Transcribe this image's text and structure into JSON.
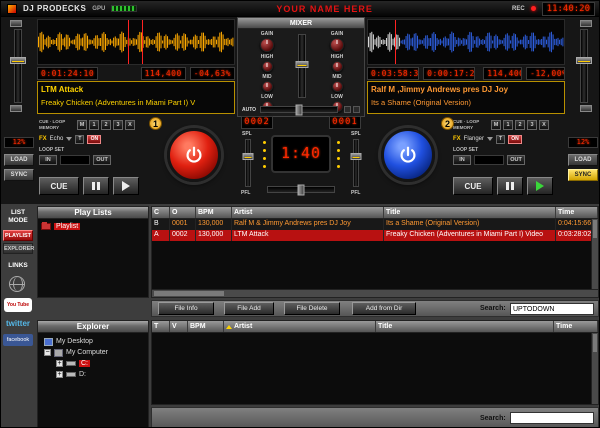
{
  "colors": {
    "deck_left_wave": "#ffaa00",
    "deck_right_wave": "#2e5fe0",
    "accent_red": "#cc1111",
    "digital_red": "#ff2800"
  },
  "header": {
    "logo": "DJ PRODECKS",
    "gpu_label": "GPU",
    "banner": "YOUR NAME HERE",
    "rec_label": "REC",
    "clock": "11:40:20"
  },
  "mixer": {
    "title": "MIXER",
    "gain_label": "GAIN",
    "eq_labels": [
      "HIGH",
      "MID",
      "LOW"
    ],
    "auto_label": "AUTO",
    "left_counter": "0002",
    "right_counter": "0001",
    "center_display": "1:40",
    "spl_label": "SPL",
    "pfl_label": "PFL"
  },
  "deck_left": {
    "badge": "1",
    "elapsed": "0:01:24:10",
    "bpm": "114,400",
    "pitch_value": "-04,63%",
    "artist_line": "LTM Attack",
    "title_line": "Freaky Chicken (Adventures in Miami Part I) V",
    "cue_loop_label": "CUE · LOOP MEMORY",
    "memory_buttons": [
      "M",
      "1",
      "2",
      "3",
      "X"
    ],
    "fx_prefix": "FX",
    "fx_name": "Echo",
    "fx_t": "T",
    "fx_on": "ON",
    "loop_set_label": "LOOP SET",
    "loop_in": "IN",
    "loop_out": "OUT",
    "pitch_display": "12%",
    "load_label": "LOAD",
    "sync_label": "SYNC",
    "cue_label": "CUE"
  },
  "deck_right": {
    "badge": "2",
    "elapsed": "0:03:58:37",
    "remaining": "0:00:17:28",
    "bpm": "114,400",
    "pitch_value": "-12,00%",
    "artist_line": "Ralf M ,Jimmy Andrews pres DJ Joy",
    "title_line": "Its a Shame (Original Version)",
    "cue_loop_label": "CUE · LOOP MEMORY",
    "memory_buttons": [
      "M",
      "1",
      "2",
      "3",
      "X"
    ],
    "fx_prefix": "FX",
    "fx_name": "Flanger",
    "fx_t": "T",
    "fx_on": "ON",
    "loop_set_label": "LOOP SET",
    "loop_in": "IN",
    "loop_out": "OUT",
    "pitch_display": "12%",
    "load_label": "LOAD",
    "sync_label": "SYNC",
    "cue_label": "CUE"
  },
  "sidebar": {
    "list_mode_label": "LIST MODE",
    "playlist_button": "PLAYLIST",
    "explorer_button": "EXPLORER",
    "links_label": "LINKS",
    "youtube": "You Tube",
    "twitter": "twitter",
    "facebook": "facebook"
  },
  "playlists": {
    "title": "Play Lists",
    "items": [
      {
        "label": "Playlist"
      }
    ]
  },
  "explorer": {
    "title": "Explorer",
    "nodes": [
      {
        "label": "My Desktop"
      },
      {
        "label": "My Computer"
      },
      {
        "label": "C:"
      },
      {
        "label": "D:"
      }
    ]
  },
  "tracklist": {
    "columns": [
      "C",
      "O",
      "BPM",
      "Artist",
      "Title",
      "Time"
    ],
    "rows": [
      {
        "c": "B",
        "o": "0001",
        "bpm": "130,000",
        "artist": "Ralf M & Jimmy Andrews pres DJ Joy",
        "title": "Its a Shame (Original Version)",
        "time": "0:04:15:66"
      },
      {
        "c": "A",
        "o": "0002",
        "bpm": "130,000",
        "artist": "LTM Attack",
        "title": "Freaky Chicken (Adventures in Miami Part I) Video",
        "time": "0:03:28:02"
      }
    ],
    "buttons": [
      "File Info",
      "File Add",
      "File Delete",
      "Add from Dir"
    ],
    "search_label": "Search:",
    "search_value": "UPTODOWN"
  },
  "browser": {
    "columns": [
      "T",
      "V",
      "BPM",
      "Artist",
      "Title",
      "Time"
    ],
    "search_label": "Search:",
    "search_value": ""
  }
}
